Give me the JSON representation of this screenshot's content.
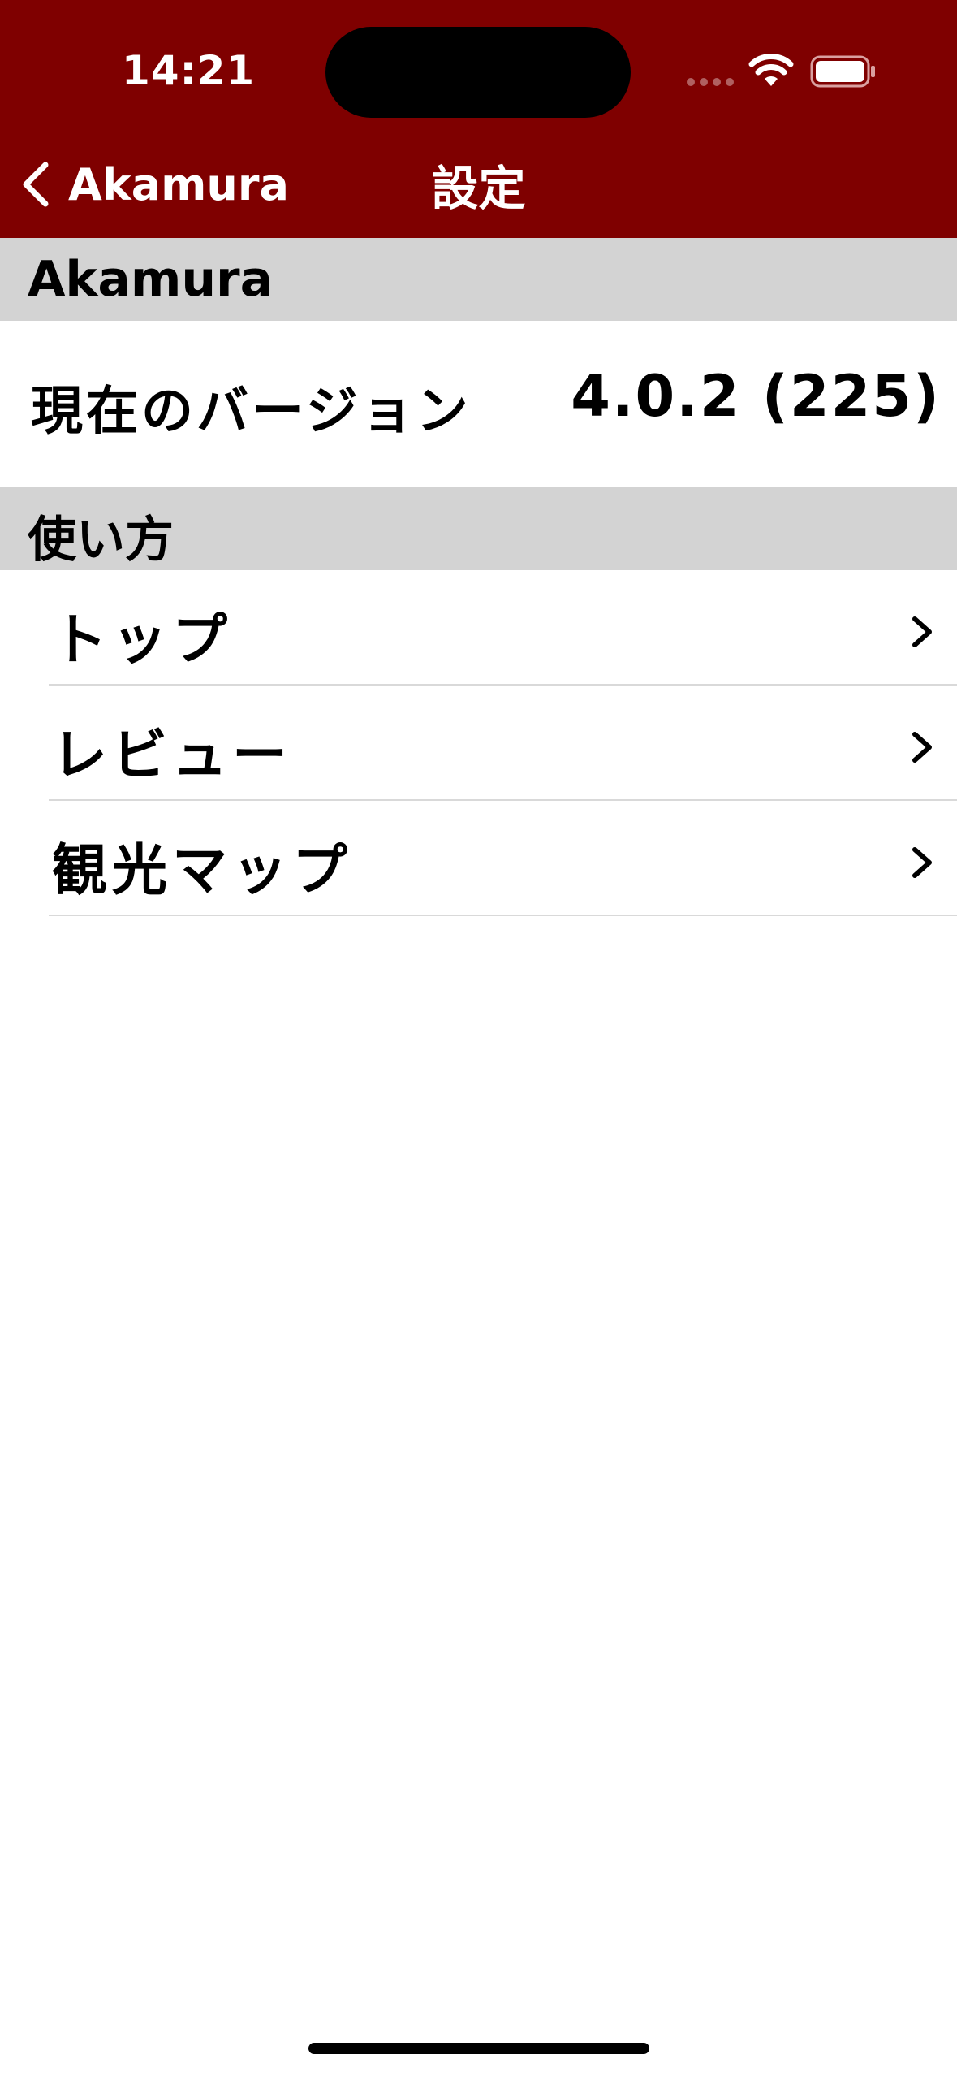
{
  "status_bar": {
    "time": "14:21"
  },
  "nav": {
    "back_label": "Akamura",
    "title": "設定"
  },
  "sections": [
    {
      "header": "Akamura",
      "version_row": {
        "label": "現在のバージョン",
        "value": "4.0.2 (225)"
      }
    },
    {
      "header": "使い方",
      "items": [
        {
          "label": "トップ"
        },
        {
          "label": "レビュー"
        },
        {
          "label": "観光マップ"
        }
      ]
    }
  ],
  "colors": {
    "nav_background": "#7f0000",
    "section_header_background": "#d3d3d3",
    "text": "#000000",
    "nav_text": "#ffffff"
  },
  "icons": {
    "back": "chevron-left-icon",
    "disclosure": "chevron-right-icon",
    "wifi": "wifi-icon",
    "battery": "battery-icon",
    "cellular": "cellular-signal-icon"
  }
}
